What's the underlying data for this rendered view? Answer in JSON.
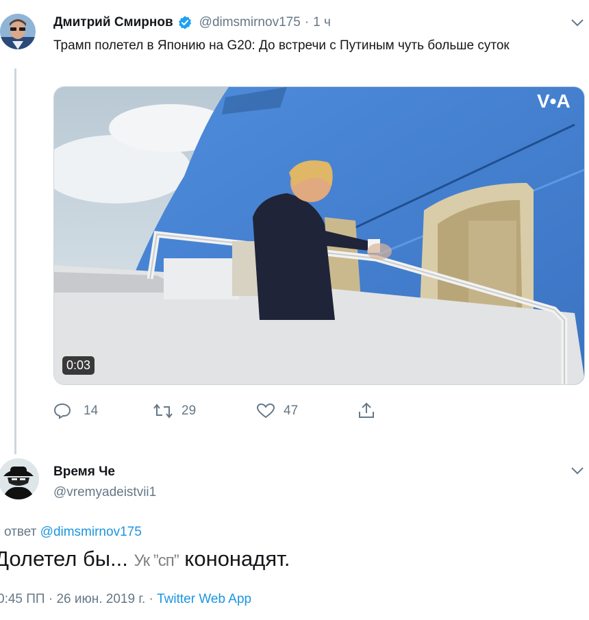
{
  "tweet1": {
    "author_name": "Дмитрий Смирнов",
    "handle": "@dimsmirnov175",
    "separator": "·",
    "time": "1 ч",
    "text": "Трамп полетел в Японию на G20: До встречи с Путиным чуть больше суток",
    "video": {
      "duration": "0:03",
      "watermark": "V•A"
    },
    "actions": {
      "replies": "14",
      "retweets": "29",
      "likes": "47"
    }
  },
  "tweet2": {
    "author_name": "Время Че",
    "handle": "@vremyadeistvii1",
    "reply_prefix": "ответ",
    "reply_to": "@dimsmirnov175",
    "text_start": "Долетел бы...",
    "text_obscured": "Ук ”сп”",
    "text_end": "кононадят.",
    "time_date": "0:45 ПП · 26 июн. 2019 г. ·",
    "source": "Twitter Web App"
  },
  "colors": {
    "accent": "#1da1f2",
    "link": "#1b95e0",
    "muted": "#657786",
    "verified": "#1da1f2",
    "plane_blue": "#4a86d8"
  }
}
